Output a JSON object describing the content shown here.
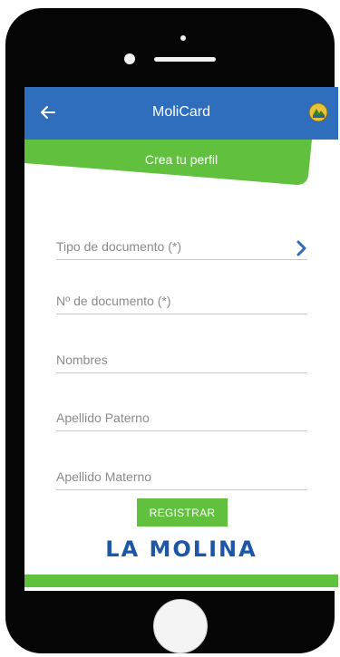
{
  "appbar": {
    "title": "MoliCard",
    "back_icon": "arrow-left-icon",
    "logo_icon": "municipal-crest-icon"
  },
  "banner": {
    "text": "Crea tu perfil"
  },
  "form": {
    "fields": [
      {
        "placeholder": "Tipo de documento (*)",
        "value": ""
      },
      {
        "placeholder": "Nº de documento (*)",
        "value": ""
      },
      {
        "placeholder": "Nombres",
        "value": ""
      },
      {
        "placeholder": "Apellido Paterno",
        "value": ""
      },
      {
        "placeholder": "Apellido Materno",
        "value": ""
      }
    ],
    "register_label": "REGISTRAR"
  },
  "brand": {
    "name": "LA MOLINA"
  },
  "colors": {
    "primary_blue": "#2f6dbd",
    "accent_green": "#61c13f",
    "chevron_blue": "#2f6dbd",
    "phone_frame": "#050505"
  }
}
